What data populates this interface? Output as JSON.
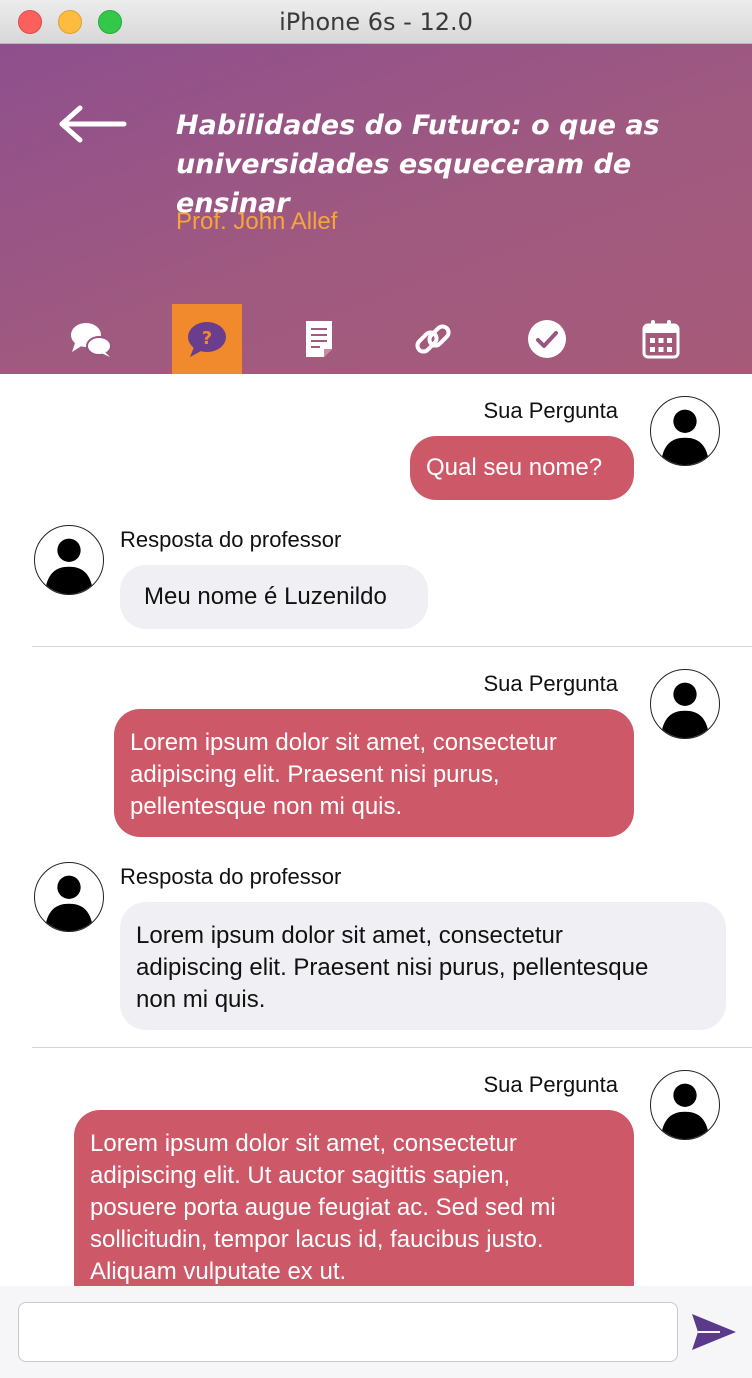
{
  "window": {
    "title": "iPhone 6s - 12.0"
  },
  "header": {
    "title_line1": "Habilidades do Futuro: o que as",
    "title_line2": "universidades esqueceram de ensinar",
    "professor": "Prof. John Allef",
    "accent_color": "#f08a2c",
    "background_colors": [
      "#8e4f8d",
      "#a65a78"
    ],
    "tabs": [
      {
        "icon": "chat-bubbles-icon",
        "active": false
      },
      {
        "icon": "question-bubble-icon",
        "active": true
      },
      {
        "icon": "document-icon",
        "active": false
      },
      {
        "icon": "link-icon",
        "active": false
      },
      {
        "icon": "check-circle-icon",
        "active": false
      },
      {
        "icon": "calendar-icon",
        "active": false
      }
    ]
  },
  "chat": {
    "question_color": "#cd5868",
    "answer_color": "#efeff4",
    "messages": [
      {
        "type": "question",
        "label": "Sua Pergunta",
        "text": "Qual seu nome?"
      },
      {
        "type": "answer",
        "label": "Resposta do professor",
        "text": "Meu nome é Luzenildo"
      },
      {
        "type": "question",
        "label": "Sua Pergunta",
        "lines": [
          "Lorem ipsum dolor sit amet, consectetur",
          "adipiscing elit. Praesent nisi purus,",
          "pellentesque non mi quis."
        ]
      },
      {
        "type": "answer",
        "label": "Resposta do professor",
        "lines": [
          "Lorem ipsum dolor sit amet, consectetur",
          "adipiscing elit. Praesent nisi purus, pellentesque",
          "non mi quis."
        ]
      },
      {
        "type": "question",
        "label": "Sua Pergunta",
        "lines": [
          "Lorem ipsum dolor sit amet, consectetur",
          "adipiscing elit. Ut auctor sagittis sapien,",
          "posuere porta augue feugiat ac. Sed sed mi",
          "sollicitudin, tempor lacus id, faucibus justo.",
          "Aliquam vulputate ex ut."
        ]
      }
    ]
  },
  "composer": {
    "value": "",
    "placeholder": "",
    "send_icon": "send-icon",
    "send_color": "#5b3a8c"
  }
}
